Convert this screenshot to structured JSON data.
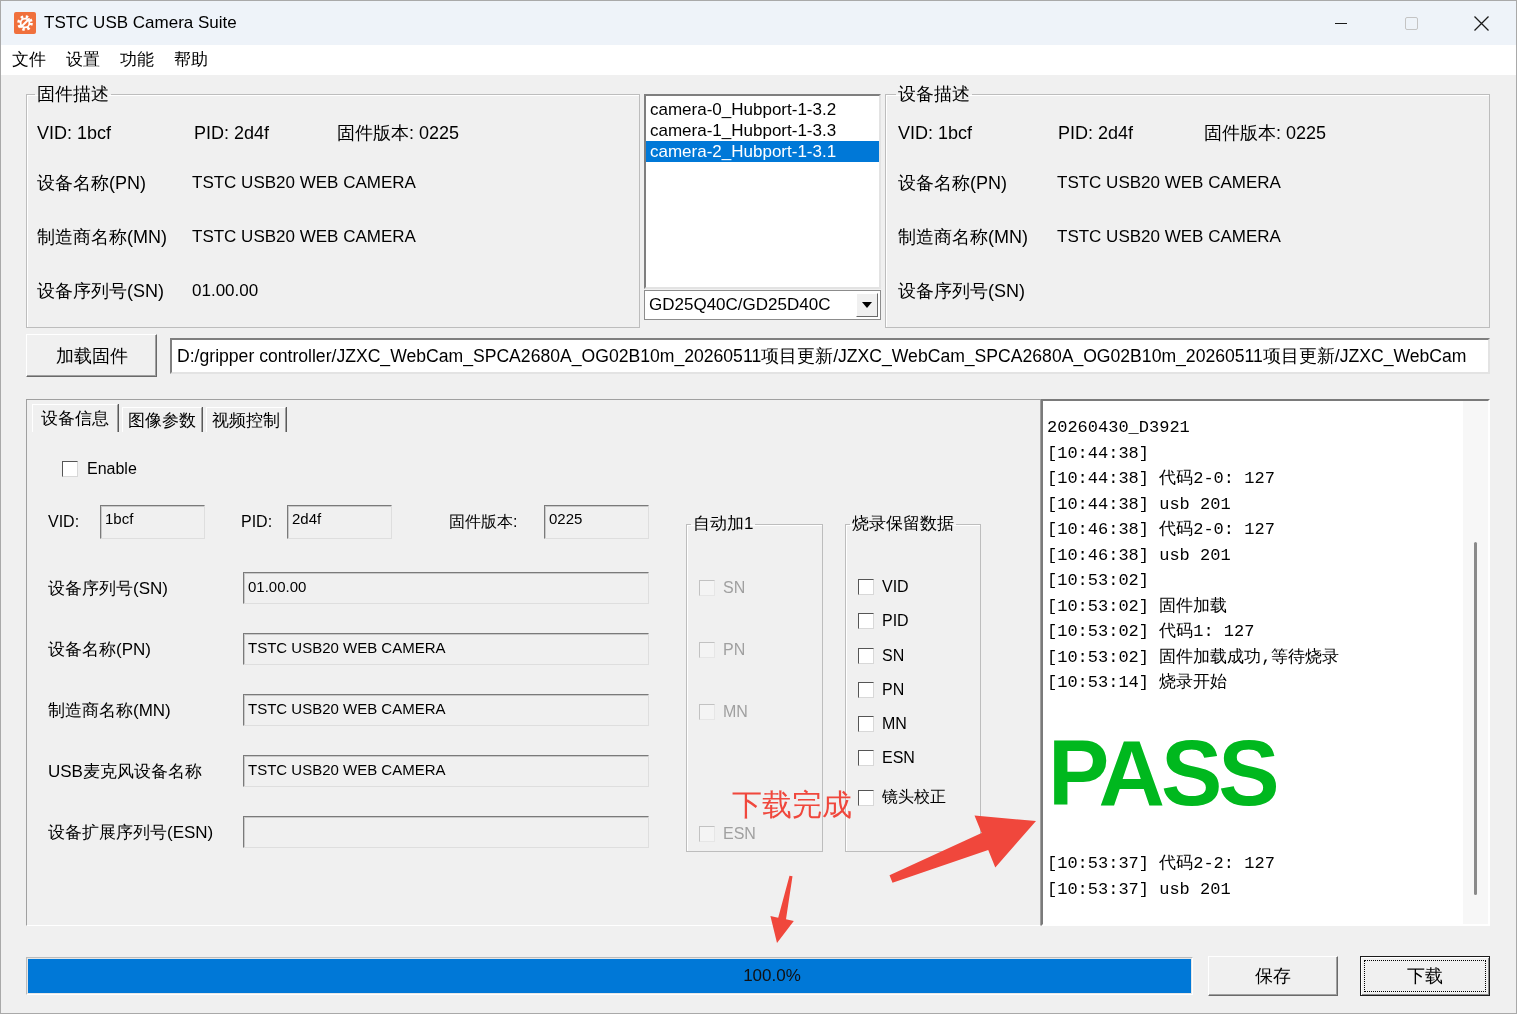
{
  "window": {
    "title": "TSTC USB Camera Suite",
    "controls": [
      {
        "kind": "minimize",
        "disabled": false
      },
      {
        "kind": "maximize",
        "disabled": true
      },
      {
        "kind": "close",
        "disabled": false
      }
    ]
  },
  "menu": [
    "文件",
    "设置",
    "功能",
    "帮助"
  ],
  "firmware_group": {
    "title": "固件描述",
    "ids": [
      "VID: 1bcf",
      "PID: 2d4f",
      "固件版本: 0225"
    ],
    "rows": [
      {
        "label": "设备名称(PN)",
        "value": "TSTC USB20 WEB CAMERA"
      },
      {
        "label": "制造商名称(MN)",
        "value": "TSTC USB20 WEB CAMERA"
      },
      {
        "label": "设备序列号(SN)",
        "value": "01.00.00"
      }
    ]
  },
  "camera_list": {
    "items": [
      {
        "label": "camera-0_Hubport-1-3.2",
        "selected": false
      },
      {
        "label": "camera-1_Hubport-1-3.3",
        "selected": false
      },
      {
        "label": "camera-2_Hubport-1-3.1",
        "selected": true
      }
    ]
  },
  "chip_dropdown": {
    "value": "GD25Q40C/GD25D40C"
  },
  "device_group": {
    "title": "设备描述",
    "ids": [
      "VID: 1bcf",
      "PID: 2d4f",
      "固件版本: 0225"
    ],
    "rows": [
      {
        "label": "设备名称(PN)",
        "value": "TSTC USB20 WEB CAMERA"
      },
      {
        "label": "制造商名称(MN)",
        "value": "TSTC USB20 WEB CAMERA"
      },
      {
        "label": "设备序列号(SN)"
      }
    ]
  },
  "load_firmware": {
    "button": "加载固件",
    "path": "D:/gripper controller/JZXC_WebCam_SPCA2680A_OG02B10m_20260511项目更新/JZXC_WebCam_SPCA2680A_OG02B10m_20260511项目更新/JZXC_WebCam"
  },
  "tabs": [
    {
      "label": "设备信息",
      "selected": true
    },
    {
      "label": "图像参数",
      "selected": false
    },
    {
      "label": "视频控制",
      "selected": false
    }
  ],
  "device_info": {
    "enable": {
      "label": "Enable",
      "checked": false
    },
    "id_fields": [
      {
        "label": "VID:",
        "value": "1bcf"
      },
      {
        "label": "PID:",
        "value": "2d4f"
      },
      {
        "label": "固件版本:",
        "value": "0225"
      }
    ],
    "fields": [
      {
        "label": "设备序列号(SN)",
        "value": "01.00.00"
      },
      {
        "label": "设备名称(PN)",
        "value": "TSTC USB20 WEB CAMERA"
      },
      {
        "label": "制造商名称(MN)",
        "value": "TSTC USB20 WEB CAMERA"
      },
      {
        "label": "USB麦克风设备名称",
        "value": "TSTC USB20 WEB CAMERA"
      },
      {
        "label": "设备扩展序列号(ESN)"
      }
    ]
  },
  "auto_increment": {
    "title": "自动加1",
    "options": [
      {
        "label": "SN",
        "checked": false,
        "disabled": true
      },
      {
        "label": "PN",
        "checked": false,
        "disabled": true
      },
      {
        "label": "MN",
        "checked": false,
        "disabled": true
      },
      {
        "label": "ESN",
        "checked": false,
        "disabled": true
      }
    ]
  },
  "retain_data": {
    "title": "烧录保留数据",
    "options": [
      {
        "label": "VID",
        "checked": false,
        "disabled": false
      },
      {
        "label": "PID",
        "checked": false,
        "disabled": false
      },
      {
        "label": "SN",
        "checked": false,
        "disabled": false
      },
      {
        "label": "PN",
        "checked": false,
        "disabled": false
      },
      {
        "label": "MN",
        "checked": false,
        "disabled": false
      },
      {
        "label": "ESN",
        "checked": false,
        "disabled": false
      },
      {
        "label": "镜头校正",
        "checked": false,
        "disabled": false
      }
    ]
  },
  "log": {
    "entries": [
      {
        "kind": "line",
        "text": "20260430_D3921"
      },
      {
        "kind": "line",
        "text": "[10:44:38]"
      },
      {
        "kind": "line",
        "text": "[10:44:38] 代码2-0: 127"
      },
      {
        "kind": "line",
        "text": "[10:44:38] usb 201"
      },
      {
        "kind": "line",
        "text": "[10:46:38] 代码2-0: 127"
      },
      {
        "kind": "line",
        "text": "[10:46:38] usb 201"
      },
      {
        "kind": "line",
        "text": "[10:53:02]"
      },
      {
        "kind": "line",
        "text": "[10:53:02] 固件加载"
      },
      {
        "kind": "line",
        "text": "[10:53:02] 代码1: 127"
      },
      {
        "kind": "line",
        "text": "[10:53:02] 固件加载成功,等待烧录"
      },
      {
        "kind": "line",
        "text": "[10:53:14] 烧录开始"
      },
      {
        "kind": "result",
        "text": "PASS",
        "color": "#00b81e"
      },
      {
        "kind": "line",
        "text": "[10:53:37] 代码2-2: 127"
      },
      {
        "kind": "line",
        "text": "[10:53:37] usb 201"
      }
    ]
  },
  "progress": {
    "level": 1,
    "text": "100.0%"
  },
  "actions": [
    {
      "label": "保存",
      "default": false
    },
    {
      "label": "下载",
      "default": true
    }
  ],
  "annotation": {
    "text": "下载完成"
  }
}
